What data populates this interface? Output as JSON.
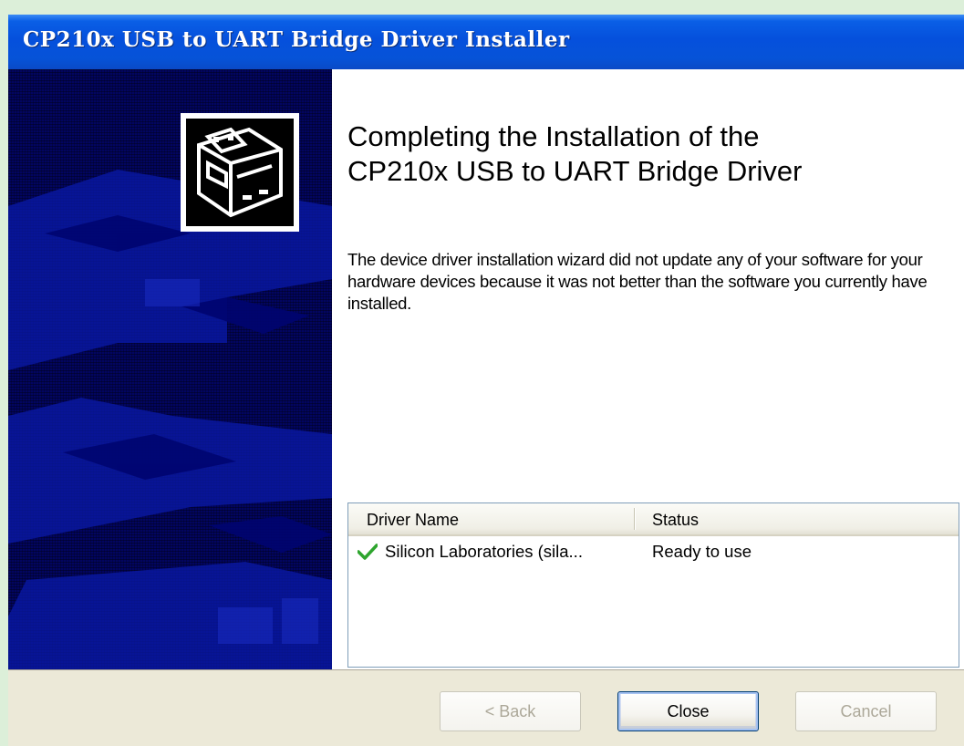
{
  "window": {
    "title": "CP210x USB to UART Bridge Driver Installer"
  },
  "wizard": {
    "heading_line1": "Completing the Installation of the",
    "heading_line2": "CP210x USB to UART Bridge Driver",
    "body": "The device driver installation wizard did not update any of your software for your hardware devices because it was not better than the software you currently have installed."
  },
  "driver_list": {
    "columns": [
      "Driver Name",
      "Status"
    ],
    "rows": [
      {
        "icon": "checkmark-icon",
        "name": "Silicon Laboratories (sila...",
        "status": "Ready to use"
      }
    ]
  },
  "buttons": {
    "back": "< Back",
    "close": "Close",
    "cancel": "Cancel"
  },
  "colors": {
    "titlebar": "#0550dc",
    "banner": "#020560",
    "footer": "#ece9d8",
    "check": "#2ea52e"
  }
}
